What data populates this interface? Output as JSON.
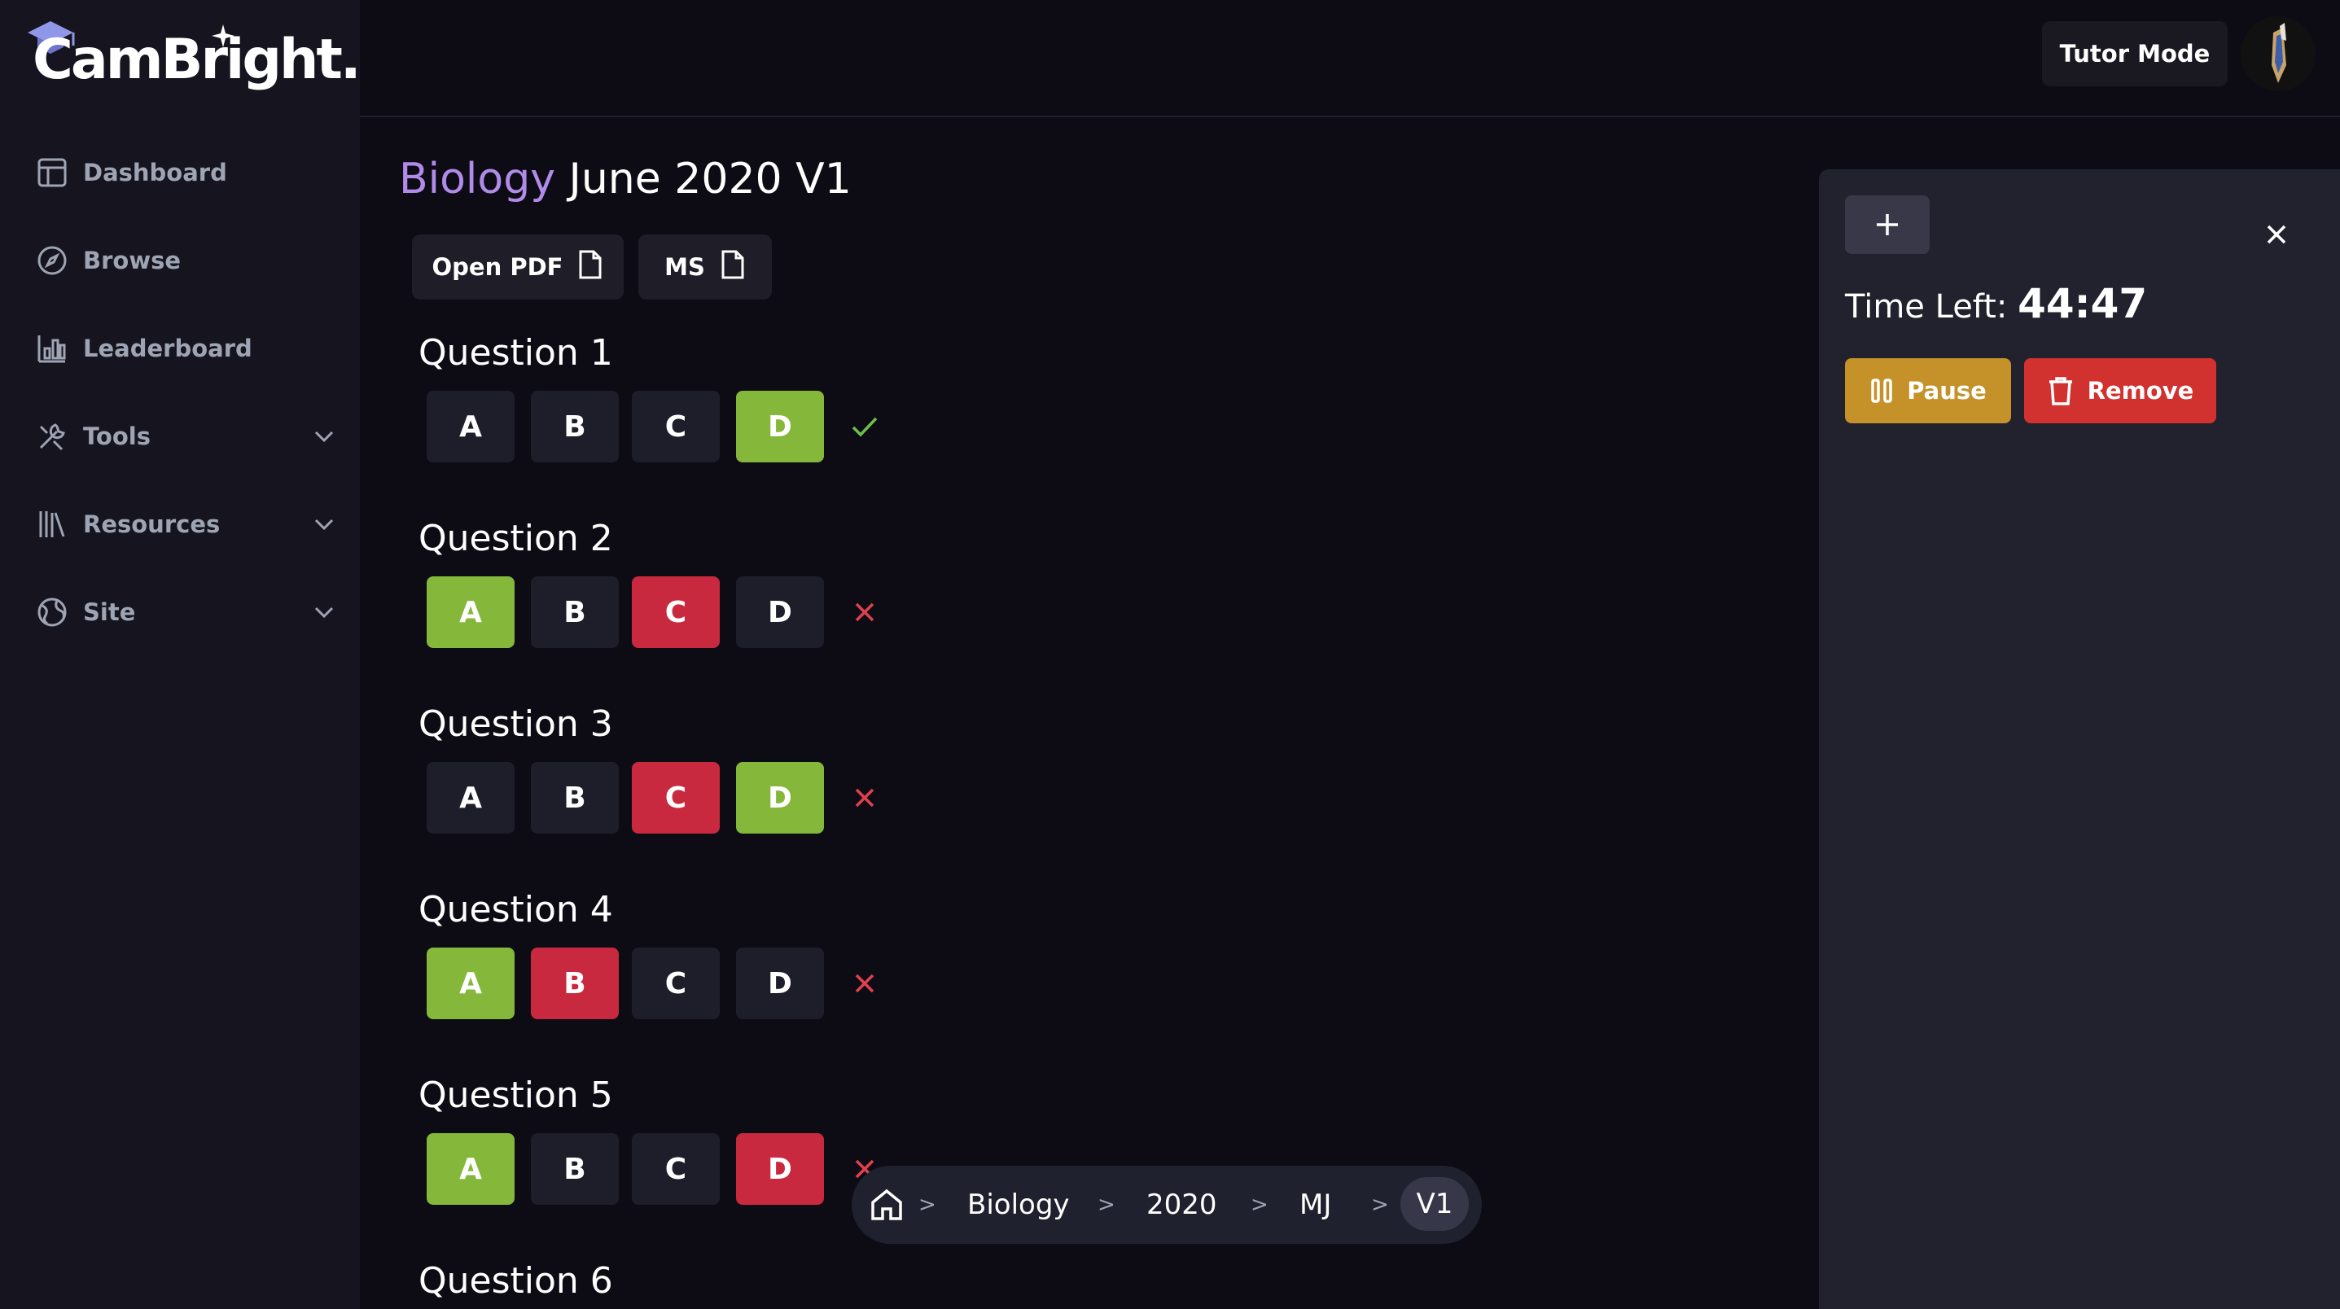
{
  "brand": {
    "name": "CamBright."
  },
  "sidebar": {
    "items": [
      {
        "label": "Dashboard",
        "icon": "layout-icon",
        "expandable": false
      },
      {
        "label": "Browse",
        "icon": "compass-icon",
        "expandable": false
      },
      {
        "label": "Leaderboard",
        "icon": "chart-icon",
        "expandable": false
      },
      {
        "label": "Tools",
        "icon": "tools-icon",
        "expandable": true
      },
      {
        "label": "Resources",
        "icon": "books-icon",
        "expandable": true
      },
      {
        "label": "Site",
        "icon": "globe-icon",
        "expandable": true
      }
    ]
  },
  "header": {
    "tutor_mode_label": "Tutor Mode"
  },
  "paper": {
    "subject": "Biology",
    "title_rest": "June 2020 V1",
    "open_pdf_label": "Open PDF",
    "ms_label": "MS"
  },
  "questions": [
    {
      "title": "Question 1",
      "options": [
        "A",
        "B",
        "C",
        "D"
      ],
      "states": [
        "none",
        "none",
        "none",
        "correct"
      ],
      "result": "correct"
    },
    {
      "title": "Question 2",
      "options": [
        "A",
        "B",
        "C",
        "D"
      ],
      "states": [
        "correct",
        "none",
        "wrong",
        "none"
      ],
      "result": "wrong"
    },
    {
      "title": "Question 3",
      "options": [
        "A",
        "B",
        "C",
        "D"
      ],
      "states": [
        "none",
        "none",
        "wrong",
        "correct"
      ],
      "result": "wrong"
    },
    {
      "title": "Question 4",
      "options": [
        "A",
        "B",
        "C",
        "D"
      ],
      "states": [
        "correct",
        "wrong",
        "none",
        "none"
      ],
      "result": "wrong"
    },
    {
      "title": "Question 5",
      "options": [
        "A",
        "B",
        "C",
        "D"
      ],
      "states": [
        "correct",
        "none",
        "none",
        "wrong"
      ],
      "result": "wrong"
    },
    {
      "title": "Question 6"
    }
  ],
  "breadcrumb": {
    "items": [
      "Biology",
      "2020",
      "MJ",
      "V1"
    ],
    "separator": ">"
  },
  "timer": {
    "time_left_label": "Time Left:",
    "time_value": "44:47",
    "pause_label": "Pause",
    "remove_label": "Remove"
  },
  "colors": {
    "accent_subject": "#b08be8",
    "correct": "#84b73a",
    "wrong": "#c8293e",
    "pause": "#c5922a",
    "remove": "#d1312f"
  }
}
